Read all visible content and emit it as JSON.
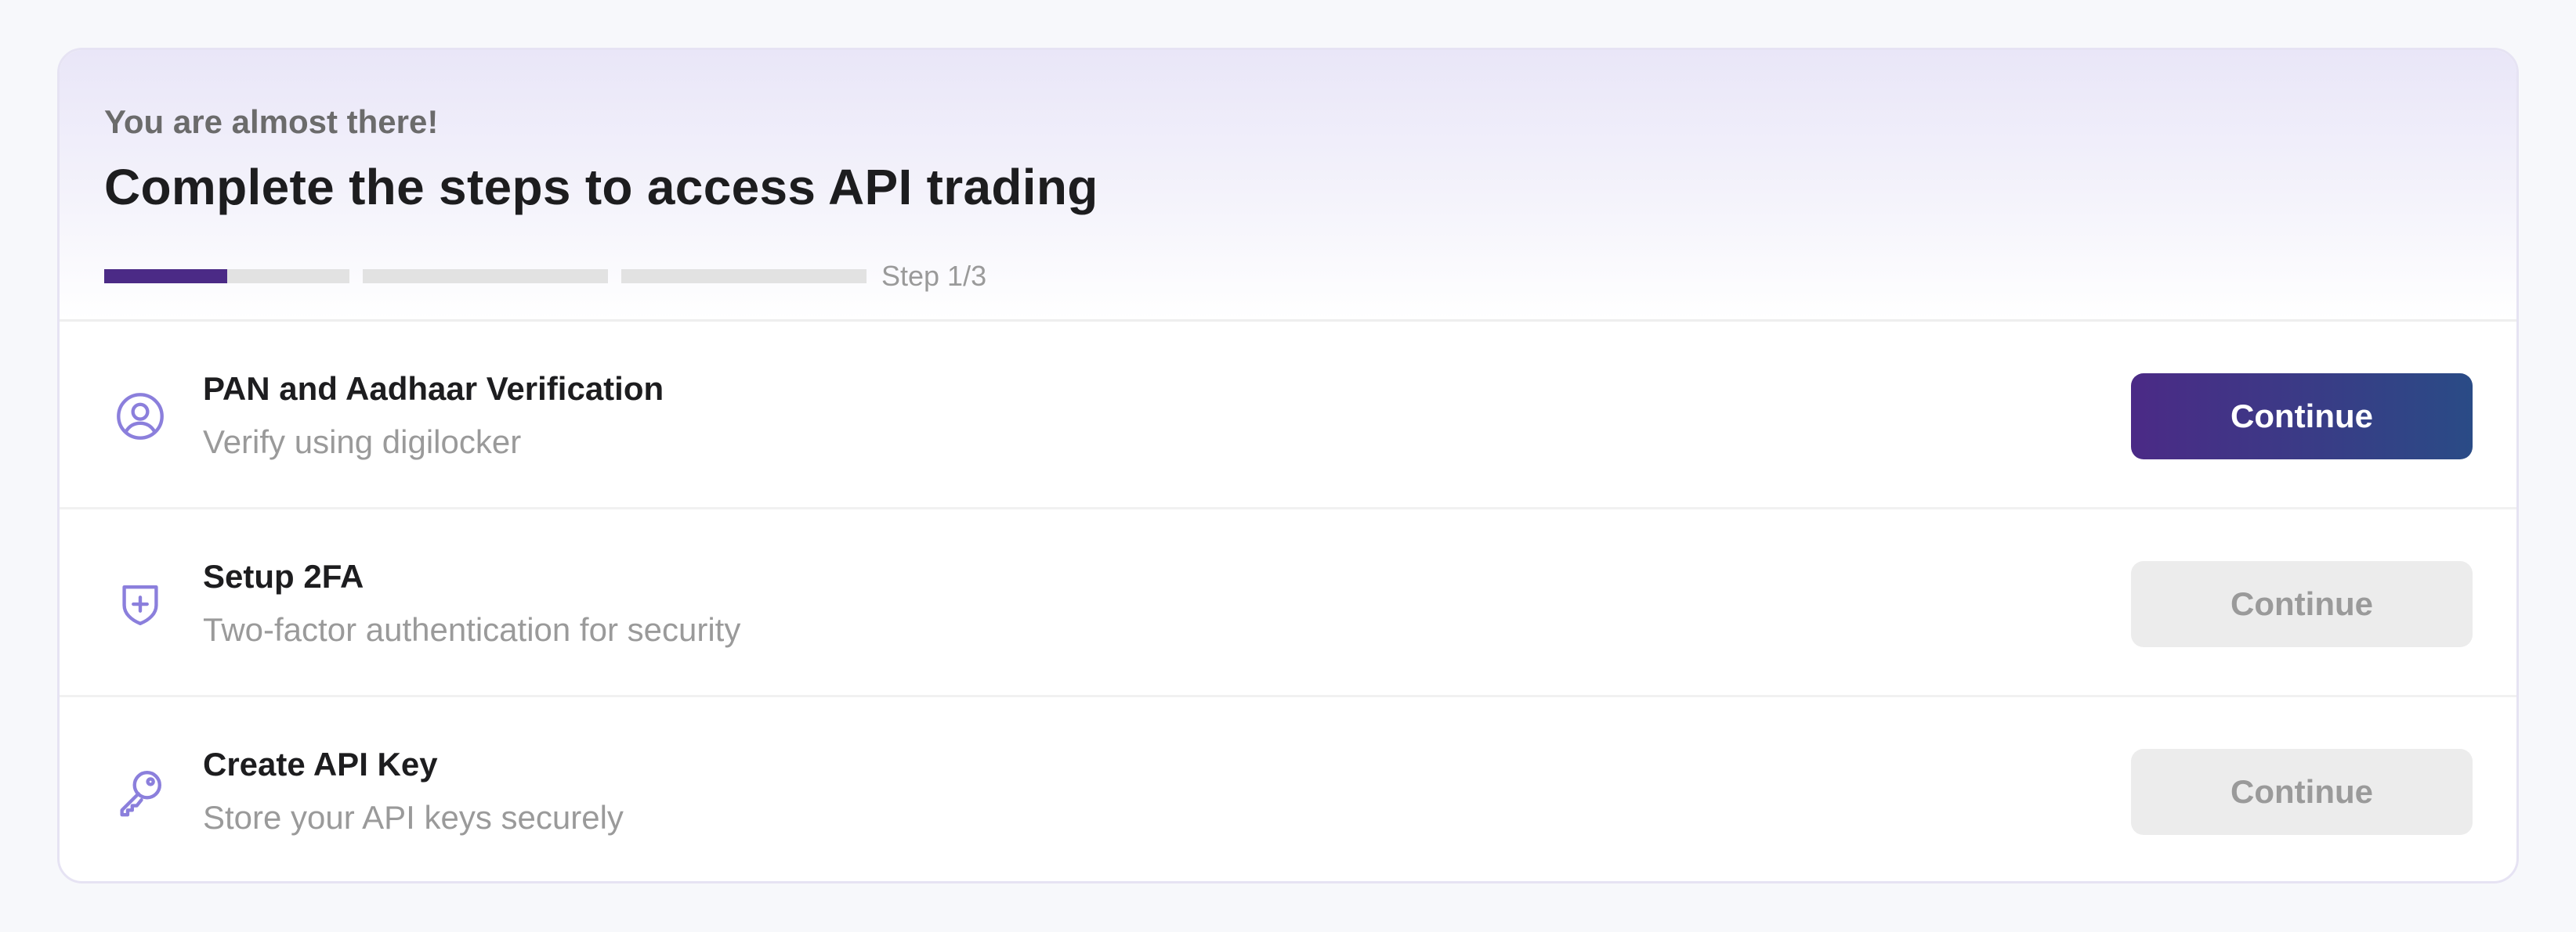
{
  "header": {
    "eyebrow": "You are almost there!",
    "title": "Complete the steps to access API trading",
    "step_label": "Step 1/3",
    "progress": {
      "segments": 3,
      "current_segment_fill_fraction": 0.5
    }
  },
  "colors": {
    "accent": "#4b2a86",
    "accent_gradient_end": "#2a4b86",
    "icon": "#8b7fdc",
    "disabled_bg": "#ececec",
    "muted_text": "#9a9a9a"
  },
  "steps": [
    {
      "icon": "user-circle-icon",
      "title": "PAN and Aadhaar Verification",
      "subtitle": "Verify using digilocker",
      "button_label": "Continue",
      "button_state": "enabled"
    },
    {
      "icon": "shield-plus-icon",
      "title": "Setup 2FA",
      "subtitle": "Two-factor authentication for security",
      "button_label": "Continue",
      "button_state": "disabled"
    },
    {
      "icon": "key-icon",
      "title": "Create API Key",
      "subtitle": "Store your API keys securely",
      "button_label": "Continue",
      "button_state": "disabled"
    }
  ]
}
